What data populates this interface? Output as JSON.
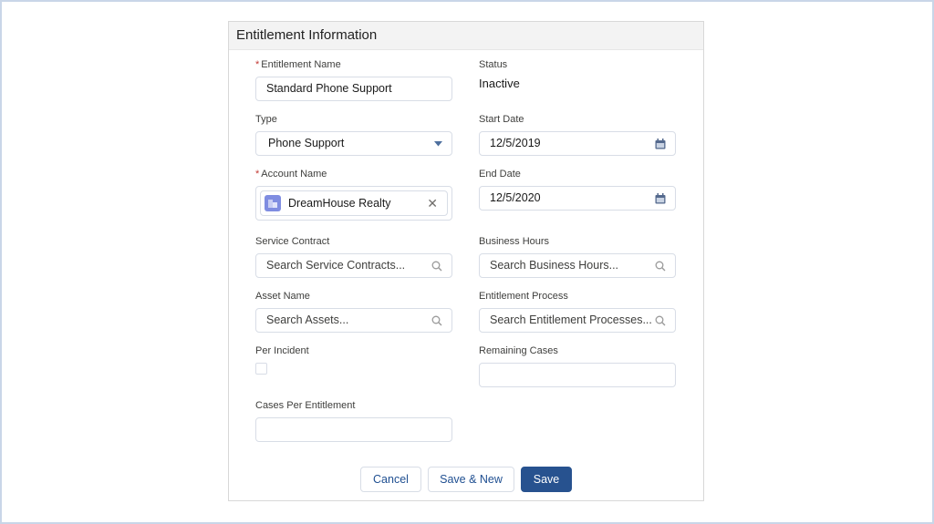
{
  "section": {
    "title": "Entitlement Information"
  },
  "fields": {
    "entitlement_name": {
      "label": "Entitlement Name",
      "required": "*",
      "value": "Standard Phone Support"
    },
    "status": {
      "label": "Status",
      "value": "Inactive"
    },
    "type": {
      "label": "Type",
      "value": "Phone Support"
    },
    "start_date": {
      "label": "Start Date",
      "value": "12/5/2019"
    },
    "account_name": {
      "label": "Account Name",
      "required": "*",
      "value": "DreamHouse Realty",
      "clear_glyph": "✕"
    },
    "end_date": {
      "label": "End Date",
      "value": "12/5/2020"
    },
    "service_contract": {
      "label": "Service Contract",
      "placeholder": "Search Service Contracts..."
    },
    "business_hours": {
      "label": "Business Hours",
      "placeholder": "Search Business Hours..."
    },
    "asset_name": {
      "label": "Asset Name",
      "placeholder": "Search Assets..."
    },
    "entitlement_process": {
      "label": "Entitlement Process",
      "placeholder": "Search Entitlement Processes..."
    },
    "per_incident": {
      "label": "Per Incident",
      "checked": false
    },
    "remaining_cases": {
      "label": "Remaining Cases",
      "value": ""
    },
    "cases_per_entitlement": {
      "label": "Cases Per Entitlement",
      "value": ""
    }
  },
  "buttons": {
    "cancel": "Cancel",
    "save_new": "Save & New",
    "save": "Save"
  },
  "colors": {
    "brand": "#27528f",
    "required": "#c23934",
    "account_icon": "#7f8de1"
  }
}
